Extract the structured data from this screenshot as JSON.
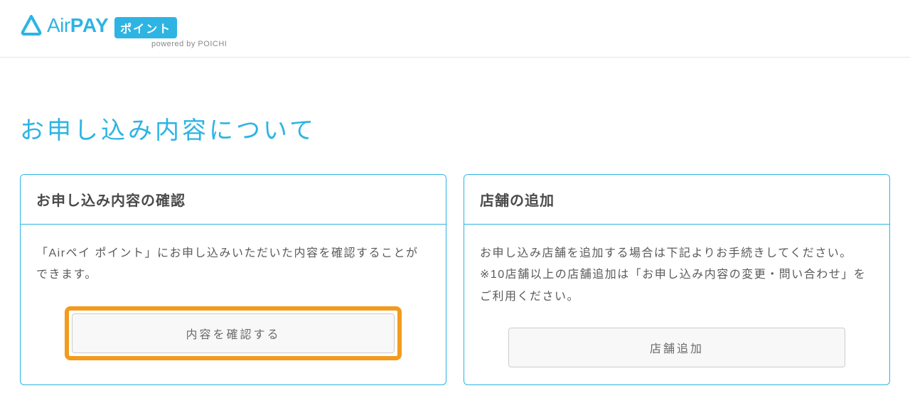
{
  "header": {
    "logo_air": "Air",
    "logo_pay": "PAY",
    "logo_badge": "ポイント",
    "logo_subtitle": "powered by POICHI"
  },
  "page": {
    "title": "お申し込み内容について"
  },
  "cards": {
    "confirm": {
      "title": "お申し込み内容の確認",
      "description": "「Airペイ ポイント」にお申し込みいただいた内容を確認することができます。",
      "button_label": "内容を確認する"
    },
    "add_store": {
      "title": "店舗の追加",
      "description": "お申し込み店舗を追加する場合は下記よりお手続きしてください。\n※10店舗以上の店舗追加は「お申し込み内容の変更・問い合わせ」をご利用ください。",
      "button_label": "店舗追加"
    }
  }
}
